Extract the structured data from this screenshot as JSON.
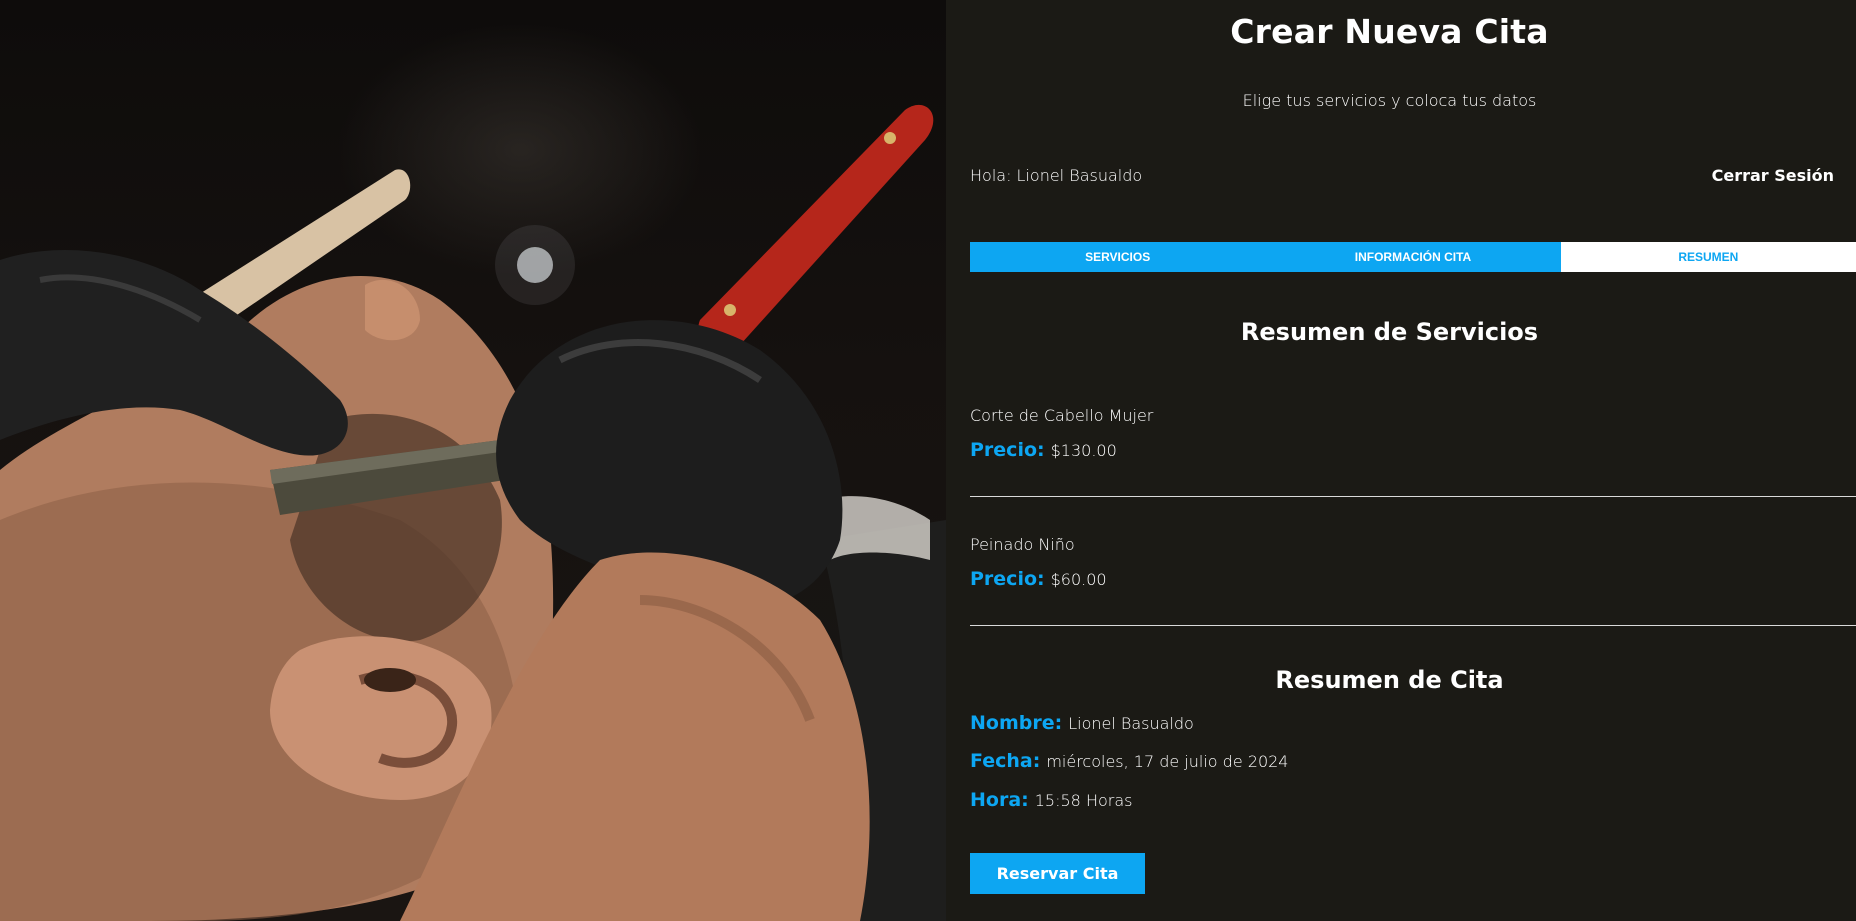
{
  "header": {
    "title": "Crear Nueva Cita",
    "subtitle": "Elige tus servicios y coloca tus datos"
  },
  "session": {
    "greeting": "Hola: Lionel Basualdo",
    "logout_label": "Cerrar Sesión"
  },
  "tabs": [
    {
      "label": "SERVICIOS",
      "active": false
    },
    {
      "label": "INFORMACIÓN CITA",
      "active": false
    },
    {
      "label": "RESUMEN",
      "active": true
    }
  ],
  "services_summary": {
    "title": "Resumen de Servicios",
    "price_label": "Precio:",
    "items": [
      {
        "name": "Corte de Cabello Mujer",
        "price": "$130.00"
      },
      {
        "name": "Peinado Niño",
        "price": "$60.00"
      }
    ]
  },
  "appointment_summary": {
    "title": "Resumen de Cita",
    "name_label": "Nombre:",
    "name_value": "Lionel Basualdo",
    "date_label": "Fecha:",
    "date_value": "miércoles, 17 de julio de 2024",
    "time_label": "Hora:",
    "time_value": "15:58 Horas"
  },
  "actions": {
    "reserve_label": "Reservar Cita"
  },
  "colors": {
    "accent": "#0da6f2",
    "background": "#1b1a15",
    "text": "#ffffff"
  }
}
